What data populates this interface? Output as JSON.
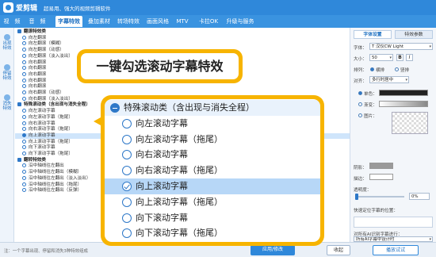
{
  "app": {
    "name": "爱剪辑",
    "slogan": "超易用、强大的视频剪辑软件"
  },
  "main_tabs": [
    {
      "label": "视　频",
      "active": false
    },
    {
      "label": "音　频",
      "active": false
    },
    {
      "label": "字幕特效",
      "active": true
    },
    {
      "label": "叠加素材",
      "active": false
    },
    {
      "label": "转场特效",
      "active": false
    },
    {
      "label": "画面风格",
      "active": false
    },
    {
      "label": "MTV",
      "active": false
    },
    {
      "label": "卡拉OK",
      "active": false
    },
    {
      "label": "升级与服务",
      "active": false
    }
  ],
  "rail": [
    {
      "label": "出现特效"
    },
    {
      "label": "停留特效"
    },
    {
      "label": "消失特效"
    }
  ],
  "effect_list": [
    {
      "label": "翻滚特效类",
      "kind": "cat"
    },
    {
      "label": "向左翻滚",
      "kind": "item"
    },
    {
      "label": "向左翻滚（模糊）",
      "kind": "item"
    },
    {
      "label": "向左翻滚（动感）",
      "kind": "item"
    },
    {
      "label": "向左翻滚（淡入淡出）",
      "kind": "item"
    },
    {
      "label": "向右翻滚",
      "kind": "item"
    },
    {
      "label": "向右翻滚",
      "kind": "item"
    },
    {
      "label": "向右翻滚",
      "kind": "item"
    },
    {
      "label": "向右翻滚",
      "kind": "item"
    },
    {
      "label": "向右翻滚",
      "kind": "item"
    },
    {
      "label": "向右翻滚（动感）",
      "kind": "item"
    },
    {
      "label": "向右翻滚（淡入淡出）",
      "kind": "item"
    },
    {
      "label": "特殊滚动类（含出现与消失全程）",
      "kind": "cat"
    },
    {
      "label": "向左滚动字幕",
      "kind": "item"
    },
    {
      "label": "向左滚动字幕（拖尾）",
      "kind": "item"
    },
    {
      "label": "向右滚动字幕",
      "kind": "item"
    },
    {
      "label": "向右滚动字幕（拖尾）",
      "kind": "item"
    },
    {
      "label": "向上滚动字幕",
      "kind": "selected"
    },
    {
      "label": "向上滚动字幕（拖尾）",
      "kind": "item"
    },
    {
      "label": "向下滚动字幕",
      "kind": "item"
    },
    {
      "label": "向下滚动字幕（拖尾）",
      "kind": "item"
    },
    {
      "label": "翻转特效类",
      "kind": "cat"
    },
    {
      "label": "沿中轴线往左翻出",
      "kind": "item"
    },
    {
      "label": "沿中轴线往左翻出（模糊）",
      "kind": "item"
    },
    {
      "label": "沿中轴线往左翻出（淡入淡出）",
      "kind": "item"
    },
    {
      "label": "沿中轴线往左翻出（拖尾）",
      "kind": "item"
    },
    {
      "label": "沿中轴线往左翻出（反弹）",
      "kind": "item"
    }
  ],
  "callout": {
    "text": "一键勾选滚动字幕特效"
  },
  "zoom_list": [
    {
      "label": "特殊滚动类（含出现与消失全程）",
      "kind": "cat"
    },
    {
      "label": "向左滚动字幕",
      "kind": "item"
    },
    {
      "label": "向左滚动字幕（拖尾）",
      "kind": "item"
    },
    {
      "label": "向右滚动字幕",
      "kind": "item"
    },
    {
      "label": "向右滚动字幕（拖尾）",
      "kind": "item"
    },
    {
      "label": "向上滚动字幕",
      "kind": "selected"
    },
    {
      "label": "向上滚动字幕（拖尾）",
      "kind": "item"
    },
    {
      "label": "向下滚动字幕",
      "kind": "item"
    },
    {
      "label": "向下滚动字幕（拖尾）",
      "kind": "item"
    }
  ],
  "right_panel": {
    "tabs": [
      {
        "label": "字体设置",
        "active": true
      },
      {
        "label": "特效参数",
        "active": false
      }
    ],
    "font_label": "字体：",
    "font_value": "T 汉仪CW Light",
    "size_label": "大小：",
    "size_value": "50",
    "bold": "B",
    "italic": "I",
    "arrange_label": "排列：",
    "arrange_h": "横排",
    "arrange_v": "竖排",
    "align_label": "对齐：",
    "align_value": "多行时居中",
    "color_label": "单色：",
    "gradient_label": "渐变：",
    "texture_label": "图片：",
    "shadow_label": "阴影：",
    "stroke_label": "描边：",
    "opacity_label": "透明度：",
    "opacity_value": "0%",
    "quick_pos_label": "快速定位字幕的位置：",
    "ai_label": "对所有AI识别字幕进行：",
    "ai_value": "所有AI字幕中设计时"
  },
  "bottom": {
    "note": "注：一个字幕出现、停留和消失3种特效组成",
    "apply": "应用/修改",
    "collapse": "收起",
    "preview": "播放试试"
  },
  "colors": {
    "brand_blue": "#2f88da",
    "callout_yellow": "#f7b400",
    "selected_row": "#cfe5fb"
  }
}
